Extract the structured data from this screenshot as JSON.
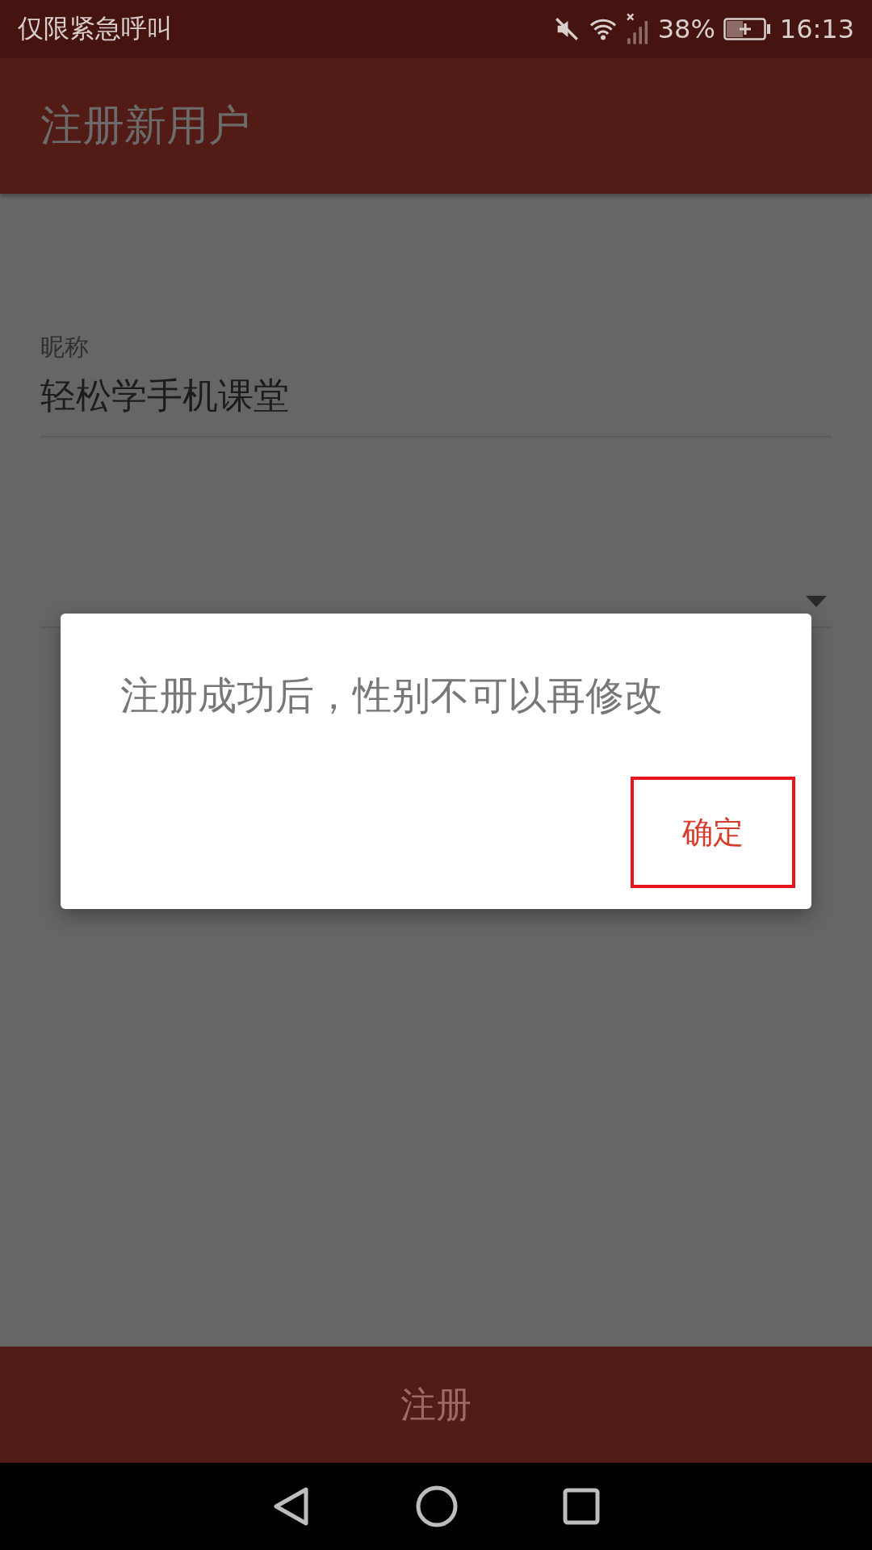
{
  "status_bar": {
    "carrier": "仅限紧急呼叫",
    "battery": "38%",
    "time": "16:13"
  },
  "app_bar": {
    "title": "注册新用户"
  },
  "form": {
    "fields": [
      {
        "kind": "text",
        "label": "昵称",
        "value": "轻松学手机课堂"
      },
      {
        "kind": "dropdown"
      }
    ]
  },
  "dialog": {
    "message": "注册成功后，性别不可以再修改",
    "button": {
      "label": "确定",
      "outlined": true
    }
  },
  "bottom_button": {
    "label": "注册",
    "disabled": true
  }
}
